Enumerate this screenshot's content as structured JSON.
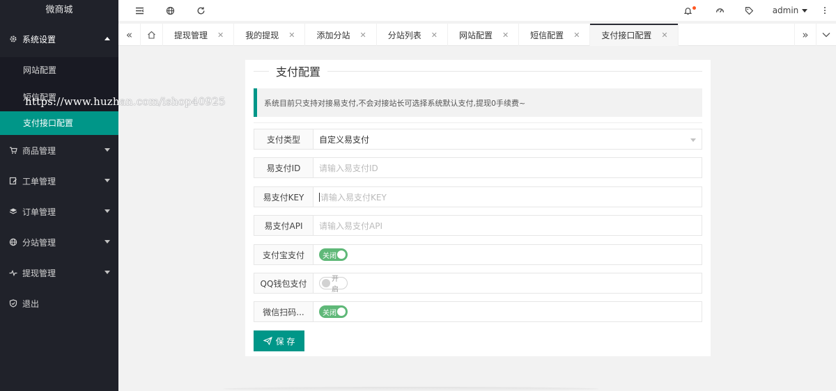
{
  "sidebar": {
    "logo": "微商城",
    "groups": [
      {
        "label": "系统设置",
        "icon": "gear-icon",
        "open": true
      },
      {
        "label": "商品管理",
        "icon": "cart-icon"
      },
      {
        "label": "工单管理",
        "icon": "edit-icon"
      },
      {
        "label": "订单管理",
        "icon": "layers-icon"
      },
      {
        "label": "分站管理",
        "icon": "globe-icon"
      },
      {
        "label": "提现管理",
        "icon": "pulse-icon"
      },
      {
        "label": "退出",
        "icon": "shield-icon"
      }
    ],
    "subitems": [
      "网站配置",
      "短信配置",
      "支付接口配置"
    ]
  },
  "header": {
    "user": "admin"
  },
  "tabs": [
    "提现管理",
    "我的提现",
    "添加分站",
    "分站列表",
    "网站配置",
    "短信配置",
    "支付接口配置"
  ],
  "card": {
    "title": "支付配置",
    "notice": "系统目前只支持对接易支付,不会对接站长可选择系统默认支付,提现0手续费~",
    "fields": {
      "pay_type_label": "支付类型",
      "pay_type_value": "自定义易支付",
      "epay_id_label": "易支付ID",
      "epay_id_placeholder": "请输入易支付ID",
      "epay_key_label": "易支付KEY",
      "epay_key_placeholder": "请输入易支付KEY",
      "epay_api_label": "易支付API",
      "epay_api_placeholder": "请输入易支付API",
      "alipay_label": "支付宝支付",
      "alipay_switch": "关闭",
      "qq_label": "QQ钱包支付",
      "qq_switch": "开启",
      "wechat_label": "微信扫码...",
      "wechat_switch": "关闭"
    },
    "save_label": "保 存"
  },
  "watermark": "https://www.huzhan.com/ishop40925",
  "colors": {
    "accent": "#009688",
    "switch_on": "#5fb878",
    "sidebar_bg": "#20222a",
    "notify_dot": "#ff5722"
  }
}
